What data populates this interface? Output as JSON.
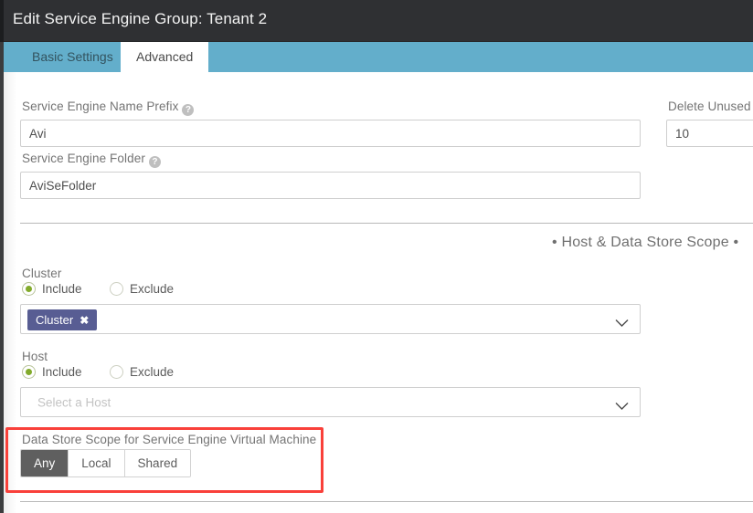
{
  "window": {
    "title": "Edit Service Engine Group: Tenant 2"
  },
  "tabs": [
    {
      "label": "Basic Settings",
      "active": false
    },
    {
      "label": "Advanced",
      "active": true
    }
  ],
  "form": {
    "se_name_prefix": {
      "label": "Service Engine Name Prefix",
      "help_icon": "help-circle-icon",
      "help_glyph": "?",
      "value": "Avi"
    },
    "se_folder": {
      "label": "Service Engine Folder",
      "help_icon": "help-circle-icon",
      "help_glyph": "?",
      "value": "AviSeFolder"
    },
    "delete_unused": {
      "label": "Delete Unused S",
      "value": "10"
    }
  },
  "section": {
    "heading": "• Host & Data Store Scope •"
  },
  "cluster": {
    "label": "Cluster",
    "options": [
      {
        "label": "Include",
        "selected": true
      },
      {
        "label": "Exclude",
        "selected": false
      }
    ],
    "chip": {
      "label": "Cluster",
      "remove_glyph": "✖"
    },
    "chevron_icon": "chevron-down-icon"
  },
  "host": {
    "label": "Host",
    "options": [
      {
        "label": "Include",
        "selected": true
      },
      {
        "label": "Exclude",
        "selected": false
      }
    ],
    "placeholder": "Select a Host",
    "chevron_icon": "chevron-down-icon"
  },
  "datastore": {
    "label": "Data Store Scope for Service Engine Virtual Machine",
    "buttons": [
      {
        "label": "Any",
        "selected": true
      },
      {
        "label": "Local",
        "selected": false
      },
      {
        "label": "Shared",
        "selected": false
      }
    ]
  },
  "colors": {
    "titlebar_bg": "#2f3033",
    "tabbar_bg": "#63aecb",
    "accent_green": "#82ab2b",
    "chip_bg": "#585d93",
    "selected_btn_bg": "#5f5f5f",
    "highlight_red": "#f9403a"
  }
}
